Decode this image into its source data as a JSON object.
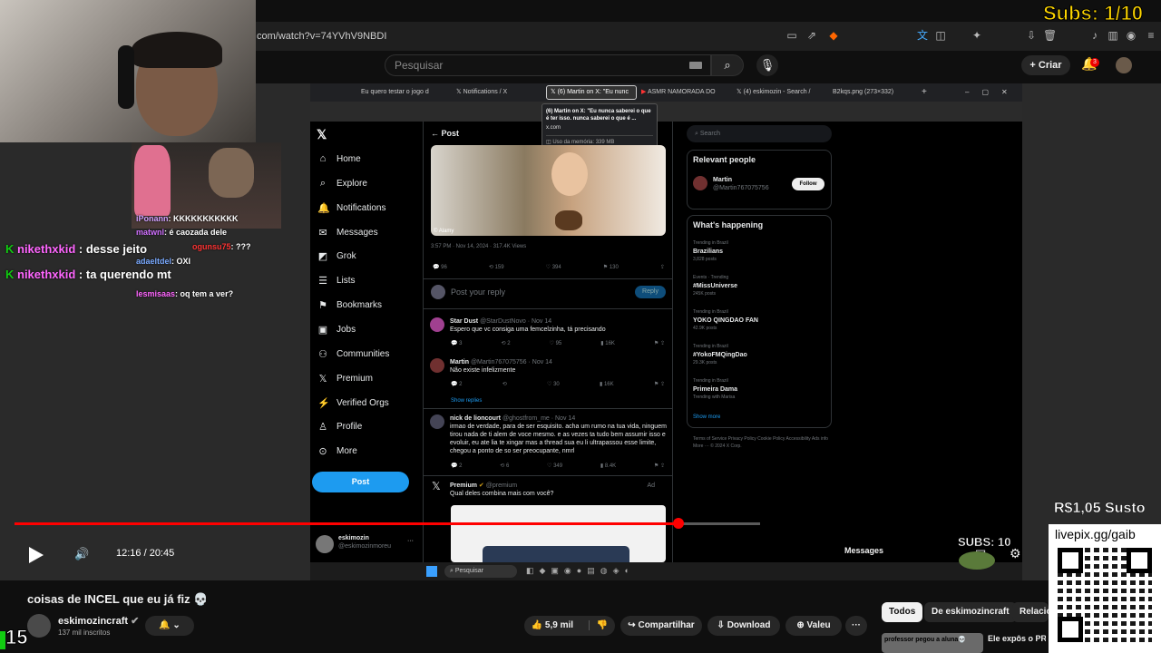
{
  "browser": {
    "url": "com/watch?v=74YVhV9NBDI"
  },
  "youtube_header": {
    "search_placeholder": "Pesquisar",
    "create_label": "Criar",
    "notifications_count": "3"
  },
  "overlays": {
    "subs_top": "Subs: 1/10",
    "subs_bottom": "SUBS: 10",
    "price": "R$1,05 Susto",
    "livepix_url": "livepix.gg/gaib",
    "counter": "15"
  },
  "chat": [
    {
      "name": "iPonann",
      "text": "KKKKKKKKKKK",
      "color": "#d0a0ff"
    },
    {
      "name": "matwnl",
      "text": "é caozada dele",
      "color": "#d070ff"
    },
    {
      "name": "nikethxkid",
      "text": "desse jeito",
      "color": "#ff66ff",
      "big": true
    },
    {
      "name": "ogunsu75",
      "text": "???",
      "color": "#ff3333"
    },
    {
      "name": "adaeltdel",
      "text": "OXI",
      "color": "#7aaaff"
    },
    {
      "name": "nikethxkid",
      "text": "ta querendo mt",
      "color": "#ff66ff",
      "big": true
    },
    {
      "name": "lesmisaas",
      "text": "oq tem a ver?",
      "color": "#ff66ff"
    }
  ],
  "screen": {
    "tabs": [
      "Eu quero testar o jogo d",
      "Notifications / X",
      "ASMR NAMORADA DO",
      "(4) eskimozin - Search /",
      "B2kqs.png (273×332)"
    ],
    "active_tab": "(6) Martin on X: \"Eu nunc",
    "tooltip": {
      "title": "(6) Martin on X: \"Eu nunca saberei o que é ter isso. nunca saberei o que é ...",
      "domain": "x.com",
      "memory": "Uso da memória: 339 MB"
    },
    "nav": [
      "Home",
      "Explore",
      "Notifications",
      "Messages",
      "Grok",
      "Lists",
      "Bookmarks",
      "Jobs",
      "Communities",
      "Premium",
      "Verified Orgs",
      "Profile",
      "More"
    ],
    "post_button": "Post",
    "user": {
      "name": "eskimozin",
      "handle": "@eskimozinmoreu"
    },
    "post_header": "Post",
    "photo_credit": "© Alamy",
    "post_meta": "3:57 PM · Nov 14, 2024 · 317.4K Views",
    "post_stats": [
      "96",
      "159",
      "394",
      "130"
    ],
    "reply_placeholder": "Post your reply",
    "reply_button": "Reply",
    "replies": [
      {
        "name": "Star Dust",
        "handle": "@StarDustNovo · Nov 14",
        "text": "Espero que vc consiga uma femcelzinha, tá precisando",
        "stats": [
          "3",
          "2",
          "95",
          "16K"
        ]
      },
      {
        "name": "Martin",
        "handle": "@Martin767075756 · Nov 14",
        "text": "Não existe infelizmente",
        "stats": [
          "2",
          "",
          "30",
          "16K"
        ]
      },
      {
        "name": "nick de lioncourt",
        "handle": "@ghostfrom_me · Nov 14",
        "text": "irmao de verdade, para de ser esquisito. acha um rumo na tua vida, ninguem tirou nada de ti alem de voce mesmo. e as vezes ta tudo bem assumir isso e evoluir, eu ate lia te xingar mas a thread sua eu li ultrapassou esse limite, chegou a ponto de so ser preocupante, nmrl",
        "stats": [
          "2",
          "6",
          "349",
          "8.4K"
        ]
      }
    ],
    "show_replies": "Show replies",
    "ad": {
      "name": "Premium",
      "handle": "@premium",
      "label": "Ad",
      "text": "Qual deles combina mais com você?"
    },
    "right": {
      "search_placeholder": "Search",
      "relevant_title": "Relevant people",
      "person_name": "Martin",
      "person_handle": "@Martin767075756",
      "follow": "Follow",
      "happening_title": "What's happening",
      "trends": [
        {
          "ctx": "Trending in Brazil",
          "name": "Brazilians",
          "count": "3,828 posts"
        },
        {
          "ctx": "Events · Trending",
          "name": "#MissUniverse",
          "count": "245K posts"
        },
        {
          "ctx": "Trending in Brazil",
          "name": "YOKO QINGDAO FAN",
          "count": "42.9K posts"
        },
        {
          "ctx": "Trending in Brazil",
          "name": "#YokoFMQingDao",
          "count": "29.3K posts"
        },
        {
          "ctx": "Trending in Brazil",
          "name": "Primeira Dama",
          "count": "Trending with Marisa"
        }
      ],
      "show_more": "Show more",
      "footer": "Terms of Service  Privacy Policy  Cookie Policy  Accessibility  Ads info  More ···  © 2024 X Corp.",
      "messages": "Messages"
    },
    "taskbar_search": "Pesquisar"
  },
  "player": {
    "time": "12:16 / 20:45",
    "progress": 0.89
  },
  "video": {
    "title": "coisas de INCEL que eu já fiz 💀",
    "channel": "eskimozincraft",
    "subscribers": "137 mil inscritos",
    "likes": "5,9 mil",
    "share": "Compartilhar",
    "download": "Download",
    "thanks": "Valeu"
  },
  "chips": [
    "Todos",
    "De eskimozincraft",
    "Relacio"
  ],
  "suggestion": {
    "title": "Ele expôs o PRO",
    "thumb_text": "professor pegou a aluna💀"
  },
  "colors": {
    "accent": "#ff0000",
    "x_blue": "#1d9bf0",
    "subs_yellow": "#ffd700"
  }
}
